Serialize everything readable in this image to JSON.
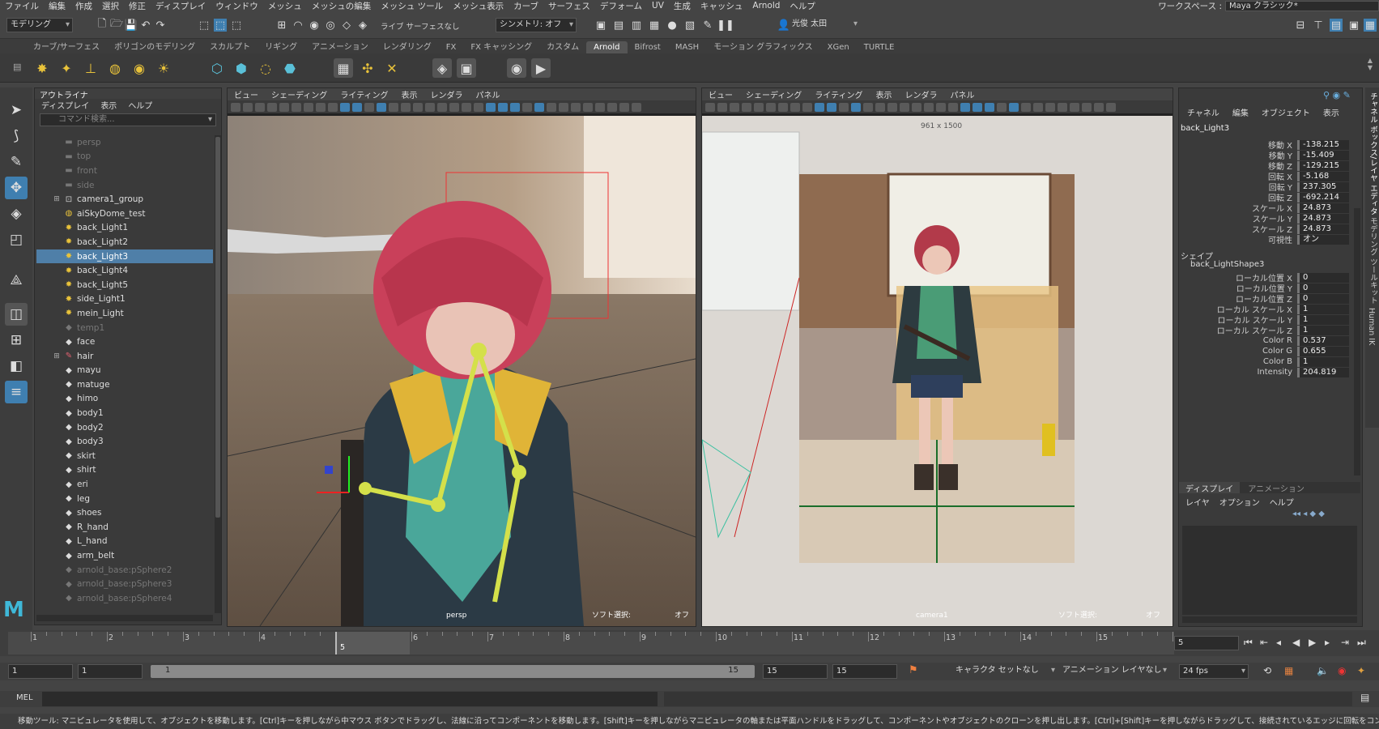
{
  "menubar": {
    "items": [
      "ファイル",
      "編集",
      "作成",
      "選択",
      "修正",
      "ディスプレイ",
      "ウィンドウ",
      "メッシュ",
      "メッシュの編集",
      "メッシュ ツール",
      "メッシュ表示",
      "カーブ",
      "サーフェス",
      "デフォーム",
      "UV",
      "生成",
      "キャッシュ",
      "Arnold",
      "ヘルプ"
    ],
    "workspace_label": "ワークスペース :",
    "workspace_value": "Maya クラシック*"
  },
  "statusline": {
    "mode_select": "モデリング",
    "live_surface": "ライブ サーフェスなし",
    "symmetry": "シンメトリ: オフ",
    "user": "光俊 太田"
  },
  "shelf": {
    "tabs": [
      "カーブ/サーフェス",
      "ポリゴンのモデリング",
      "スカルプト",
      "リギング",
      "アニメーション",
      "レンダリング",
      "FX",
      "FX キャッシング",
      "カスタム",
      "Arnold",
      "Bifrost",
      "MASH",
      "モーション グラフィックス",
      "XGen",
      "TURTLE"
    ],
    "active_tab": "Arnold"
  },
  "outliner": {
    "title": "アウトライナ",
    "menu": [
      "ディスプレイ",
      "表示",
      "ヘルプ"
    ],
    "search_placeholder": "コマンド検索...",
    "items": [
      {
        "label": "persp",
        "icon": "camera",
        "dim": true
      },
      {
        "label": "top",
        "icon": "camera",
        "dim": true
      },
      {
        "label": "front",
        "icon": "camera",
        "dim": true
      },
      {
        "label": "side",
        "icon": "camera",
        "dim": true
      },
      {
        "label": "camera1_group",
        "icon": "group",
        "expand": true
      },
      {
        "label": "aiSkyDome_test",
        "icon": "dome"
      },
      {
        "label": "back_Light1",
        "icon": "light"
      },
      {
        "label": "back_Light2",
        "icon": "light"
      },
      {
        "label": "back_Light3",
        "icon": "light",
        "selected": true
      },
      {
        "label": "back_Light4",
        "icon": "light"
      },
      {
        "label": "back_Light5",
        "icon": "light"
      },
      {
        "label": "side_Light1",
        "icon": "light"
      },
      {
        "label": "mein_Light",
        "icon": "light"
      },
      {
        "label": "temp1",
        "icon": "mesh",
        "dim": true
      },
      {
        "label": "face",
        "icon": "mesh"
      },
      {
        "label": "hair",
        "icon": "hair",
        "expand": true
      },
      {
        "label": "mayu",
        "icon": "mesh"
      },
      {
        "label": "matuge",
        "icon": "mesh"
      },
      {
        "label": "himo",
        "icon": "mesh"
      },
      {
        "label": "body1",
        "icon": "mesh"
      },
      {
        "label": "body2",
        "icon": "mesh"
      },
      {
        "label": "body3",
        "icon": "mesh"
      },
      {
        "label": "skirt",
        "icon": "mesh"
      },
      {
        "label": "shirt",
        "icon": "mesh"
      },
      {
        "label": "eri",
        "icon": "mesh"
      },
      {
        "label": "leg",
        "icon": "mesh"
      },
      {
        "label": "shoes",
        "icon": "mesh"
      },
      {
        "label": "R_hand",
        "icon": "mesh"
      },
      {
        "label": "L_hand",
        "icon": "mesh"
      },
      {
        "label": "arm_belt",
        "icon": "mesh"
      },
      {
        "label": "arnold_base:pSphere2",
        "icon": "mesh",
        "dim": true
      },
      {
        "label": "arnold_base:pSphere3",
        "icon": "mesh",
        "dim": true
      },
      {
        "label": "arnold_base:pSphere4",
        "icon": "mesh",
        "dim": true
      }
    ]
  },
  "viewport_left": {
    "menu": [
      "ビュー",
      "シェーディング",
      "ライティング",
      "表示",
      "レンダラ",
      "パネル"
    ],
    "camera_label": "persp",
    "soft_select_label": "ソフト選択:",
    "soft_select_value": "オフ"
  },
  "viewport_right": {
    "menu": [
      "ビュー",
      "シェーディング",
      "ライティング",
      "表示",
      "レンダラ",
      "パネル"
    ],
    "resolution": "961 x 1500",
    "camera_label": "camera1",
    "soft_select_label": "ソフト選択:",
    "soft_select_value": "オフ"
  },
  "channel_box": {
    "menu": [
      "チャネル",
      "編集",
      "オブジェクト",
      "表示"
    ],
    "object": "back_Light3",
    "transform_attrs": [
      {
        "name": "移動 X",
        "value": "-138.215"
      },
      {
        "name": "移動 Y",
        "value": "-15.409"
      },
      {
        "name": "移動 Z",
        "value": "-129.215"
      },
      {
        "name": "回転 X",
        "value": "-5.168"
      },
      {
        "name": "回転 Y",
        "value": "237.305"
      },
      {
        "name": "回転 Z",
        "value": "-692.214"
      },
      {
        "name": "スケール X",
        "value": "24.873"
      },
      {
        "name": "スケール Y",
        "value": "24.873"
      },
      {
        "name": "スケール Z",
        "value": "24.873"
      },
      {
        "name": "可視性",
        "value": "オン"
      }
    ],
    "shapes_label": "シェイプ",
    "shape_name": "back_LightShape3",
    "shape_attrs": [
      {
        "name": "ローカル位置 X",
        "value": "0"
      },
      {
        "name": "ローカル位置 Y",
        "value": "0"
      },
      {
        "name": "ローカル位置 Z",
        "value": "0"
      },
      {
        "name": "ローカル スケール X",
        "value": "1"
      },
      {
        "name": "ローカル スケール Y",
        "value": "1"
      },
      {
        "name": "ローカル スケール Z",
        "value": "1"
      },
      {
        "name": "Color R",
        "value": "0.537"
      },
      {
        "name": "Color G",
        "value": "0.655"
      },
      {
        "name": "Color B",
        "value": "1"
      },
      {
        "name": "Intensity",
        "value": "204.819"
      }
    ],
    "layer_tabs": [
      "ディスプレイ",
      "アニメーション"
    ],
    "layer_menu": [
      "レイヤ",
      "オプション",
      "ヘルプ"
    ]
  },
  "side_tabs": [
    "チャネル ボックス/レイヤ エディタ",
    "モデリング ツールキット",
    "Human IK"
  ],
  "timeline": {
    "ticks": [
      "1",
      "2",
      "3",
      "4",
      "5",
      "6",
      "7",
      "8",
      "9",
      "10",
      "11",
      "12",
      "13",
      "14",
      "15"
    ],
    "current_frame": "5",
    "current_frame_field": "5"
  },
  "range": {
    "start": "1",
    "playback_start": "1",
    "slider_start": "1",
    "slider_end": "15",
    "playback_end": "15",
    "end": "15",
    "character_set": "キャラクタ セットなし",
    "anim_layer": "アニメーション レイヤなし",
    "fps": "24 fps"
  },
  "mel": {
    "label": "MEL"
  },
  "help_line": "移動ツール: マニピュレータを使用して、オブジェクトを移動します。[Ctrl]キーを押しながら中マウス ボタンでドラッグし、法線に沿ってコンポーネントを移動します。[Shift]キーを押しながらマニピュレータの軸または平面ハンドルをドラッグして、コンポーネントやオブジェクトのクローンを押し出します。[Ctrl]+[Shift]キーを押しながらドラッグして、接続されているエッジに回転をコンストレイントします。[D]または[Insert]キーを押して、ピボットの位置および",
  "colors": {
    "selection": "#4f7fa8",
    "accent": "#3f7fb0",
    "bg": "#444444"
  }
}
